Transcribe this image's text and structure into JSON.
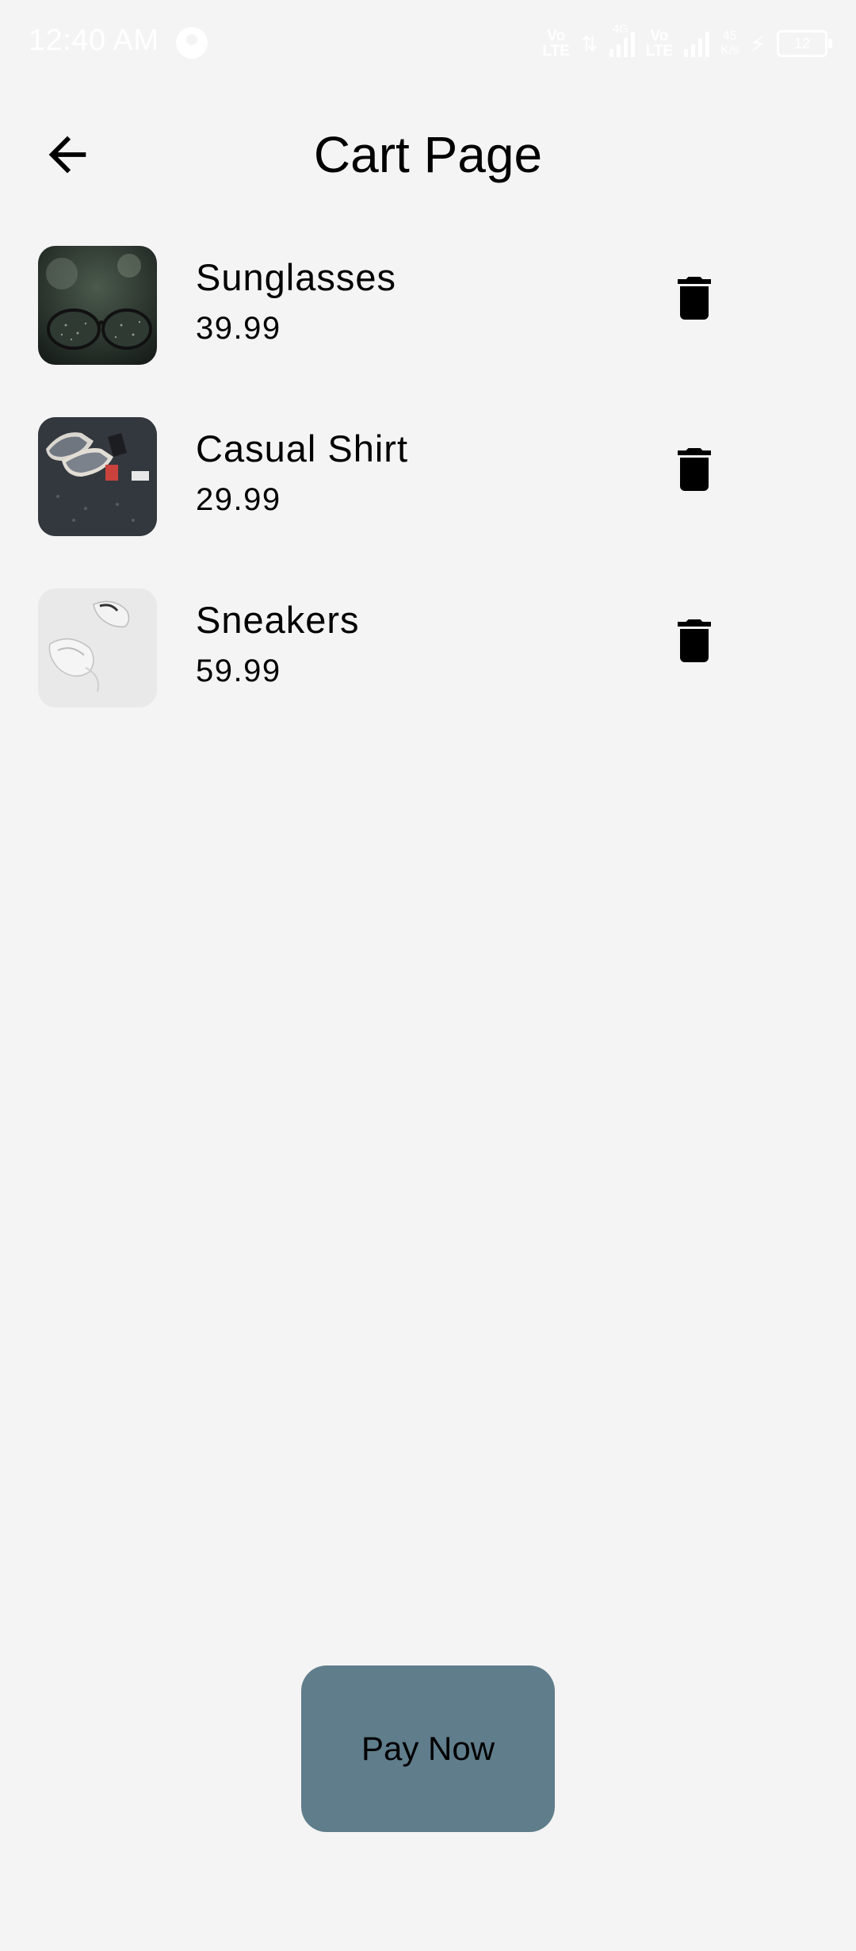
{
  "status_bar": {
    "time": "12:40 AM",
    "lte1": "Vo\nLTE",
    "net_4g": "4G",
    "lte2": "Vo\nLTE",
    "speed": "45\nK/s",
    "battery": "12",
    "icons": [
      "app-notification-icon",
      "signal-icon",
      "charging-icon",
      "battery-icon"
    ]
  },
  "header": {
    "title": "Cart Page",
    "back_icon": "arrow-left-icon"
  },
  "cart": {
    "items": [
      {
        "name": "Sunglasses",
        "price": "39.99",
        "image": "sunglasses-photo",
        "delete_icon": "trash-icon"
      },
      {
        "name": "Casual Shirt",
        "price": "29.99",
        "image": "shoes-flatlay-photo",
        "delete_icon": "trash-icon"
      },
      {
        "name": "Sneakers",
        "price": "59.99",
        "image": "sneakers-photo",
        "delete_icon": "trash-icon"
      }
    ]
  },
  "footer": {
    "pay_label": "Pay Now"
  },
  "colors": {
    "background": "#f4f4f4",
    "pay_button": "#607d8b",
    "text": "#000000"
  }
}
